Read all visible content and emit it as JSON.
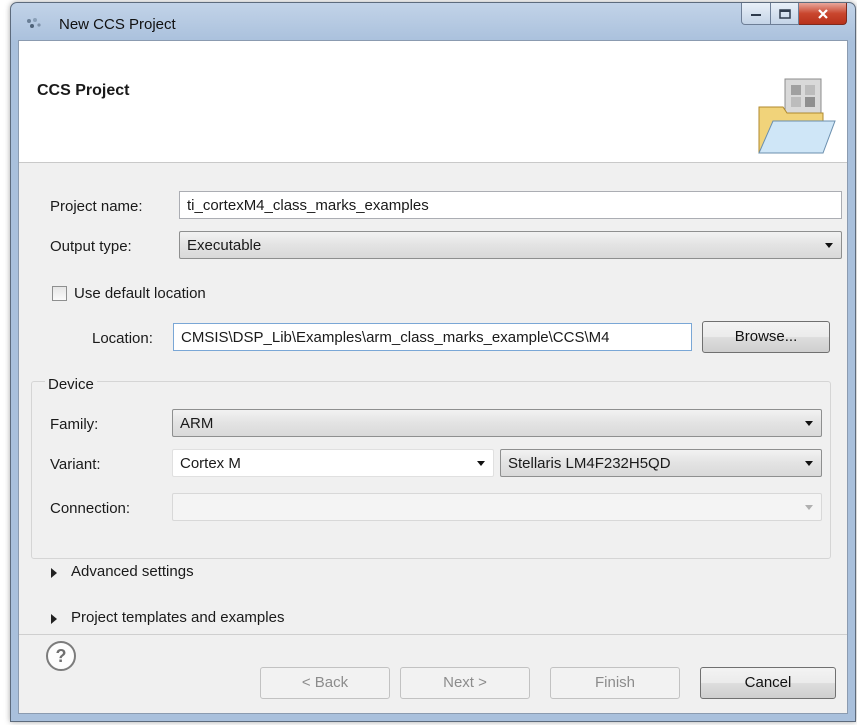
{
  "window": {
    "title": "New CCS Project"
  },
  "banner": {
    "title": "CCS Project"
  },
  "form": {
    "project_name_label": "Project name:",
    "project_name_value": "ti_cortexM4_class_marks_examples",
    "output_type_label": "Output type:",
    "output_type_value": "Executable",
    "use_default_location_label": "Use default location",
    "use_default_location_checked": false,
    "location_label": "Location:",
    "location_value": "CMSIS\\DSP_Lib\\Examples\\arm_class_marks_example\\CCS\\M4",
    "browse_label": "Browse..."
  },
  "device": {
    "group_title": "Device",
    "family_label": "Family:",
    "family_value": "ARM",
    "variant_label": "Variant:",
    "variant_filter_value": "Cortex M",
    "variant_value": "Stellaris LM4F232H5QD",
    "connection_label": "Connection:",
    "connection_value": ""
  },
  "sections": {
    "advanced_settings": "Advanced settings",
    "project_templates": "Project templates and examples"
  },
  "footer": {
    "help_symbol": "?",
    "back_label": "< Back",
    "next_label": "Next >",
    "finish_label": "Finish",
    "cancel_label": "Cancel"
  },
  "colors": {
    "titlebar": "#a9c0dc",
    "close_button": "#c9462e",
    "dialog_bg": "#f0f0f0"
  }
}
